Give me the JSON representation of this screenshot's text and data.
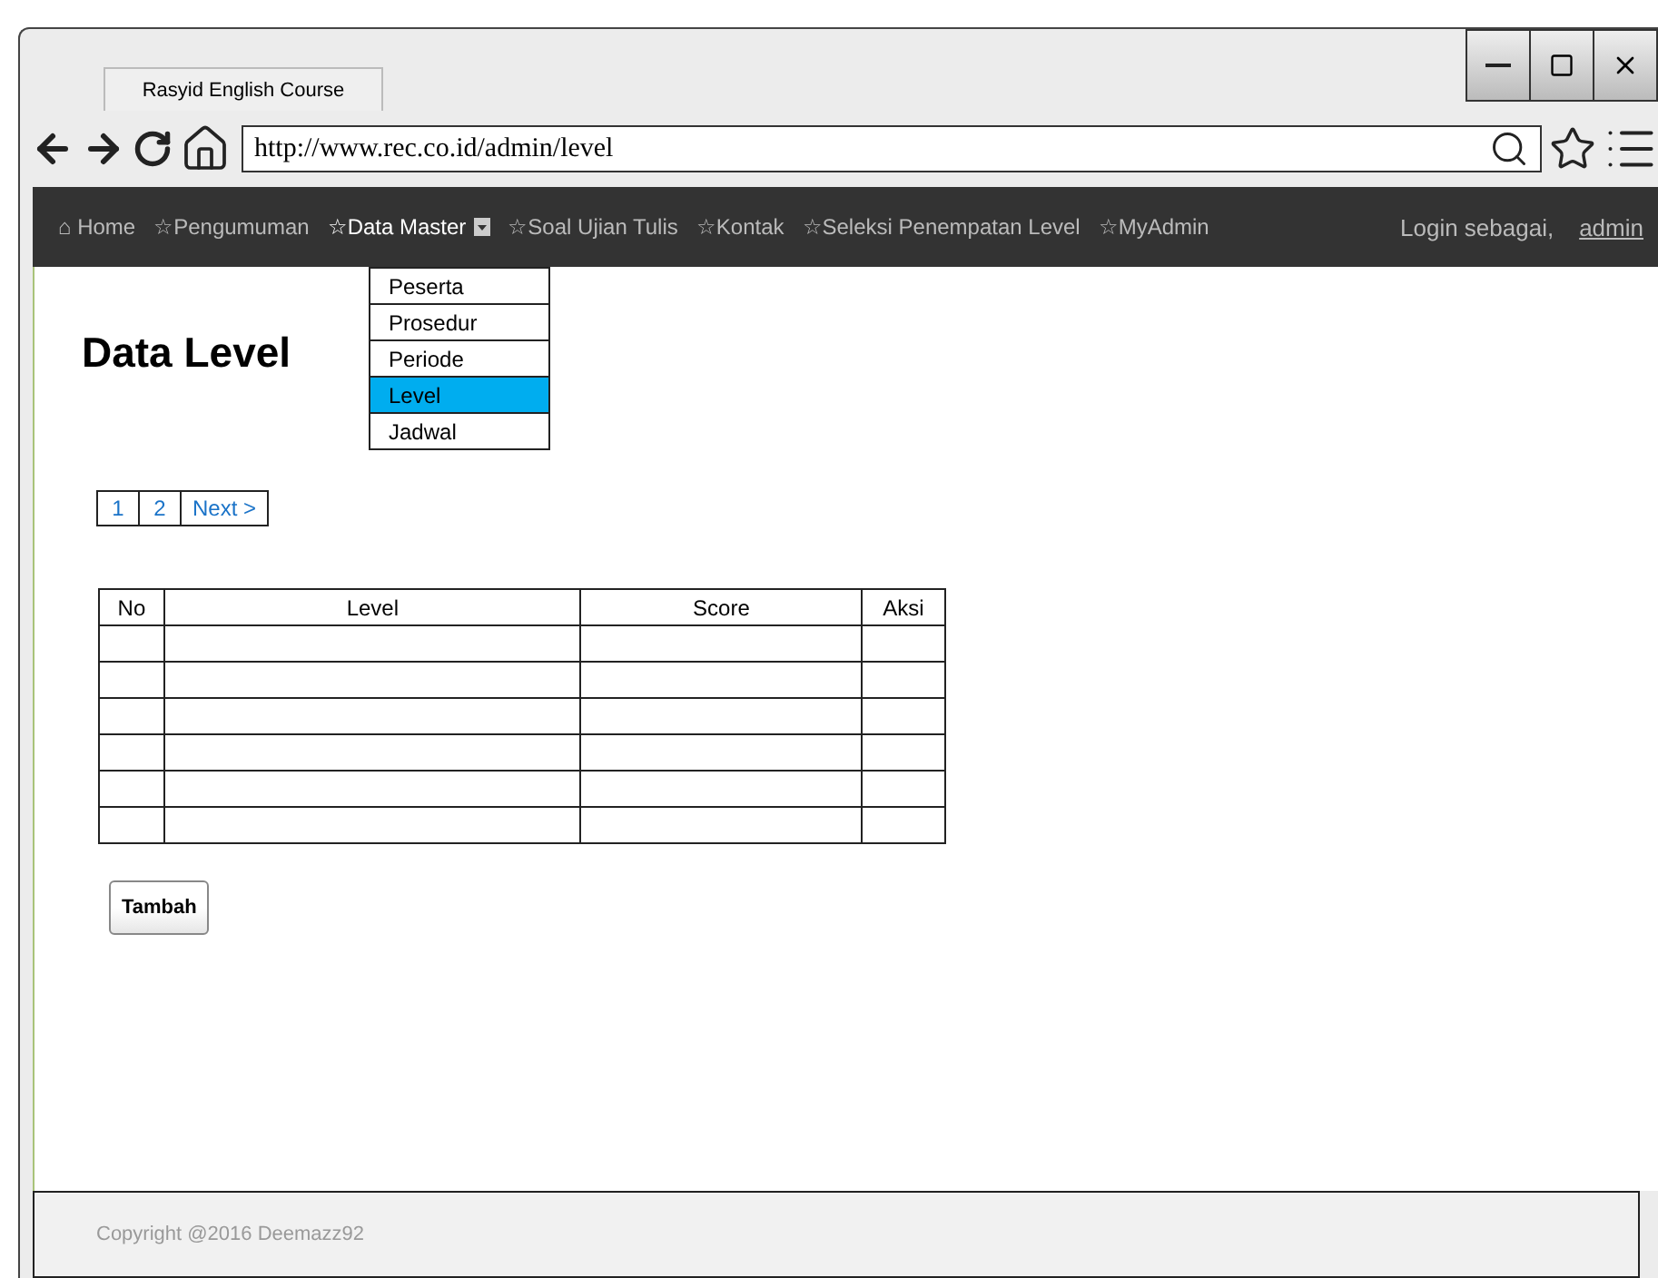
{
  "browser": {
    "tab_title": "Rasyid English Course",
    "url": "http://www.rec.co.id/admin/level"
  },
  "nav": {
    "items": [
      {
        "label": "⌂ Home",
        "selected": false,
        "has_menu": false
      },
      {
        "label": "☆Pengumuman",
        "selected": false,
        "has_menu": false
      },
      {
        "label": "☆Data Master",
        "selected": true,
        "has_menu": true
      },
      {
        "label": "☆Soal Ujian Tulis",
        "selected": false,
        "has_menu": false
      },
      {
        "label": "☆Kontak",
        "selected": false,
        "has_menu": false
      },
      {
        "label": "☆Seleksi Penempatan Level",
        "selected": false,
        "has_menu": false
      },
      {
        "label": "☆MyAdmin",
        "selected": false,
        "has_menu": false
      }
    ],
    "login_text": "Login sebagai,",
    "login_link": "admin"
  },
  "dropdown": {
    "items": [
      {
        "label": "Peserta",
        "selected": false
      },
      {
        "label": "Prosedur",
        "selected": false
      },
      {
        "label": "Periode",
        "selected": false
      },
      {
        "label": "Level",
        "selected": true
      },
      {
        "label": "Jadwal",
        "selected": false
      }
    ]
  },
  "page_title": "Data Level",
  "pagination": [
    "1",
    "2",
    "Next >"
  ],
  "table": {
    "columns": [
      "No",
      "Level",
      "Score",
      "Aksi"
    ],
    "rows": [
      {
        "kind": "empty"
      },
      {
        "kind": "empty"
      },
      {
        "kind": "empty"
      },
      {
        "kind": "empty"
      },
      {
        "kind": "empty"
      },
      {
        "kind": "empty"
      }
    ]
  },
  "add_button": "Tambah",
  "footer": "Copyright @2016 Deemazz92"
}
